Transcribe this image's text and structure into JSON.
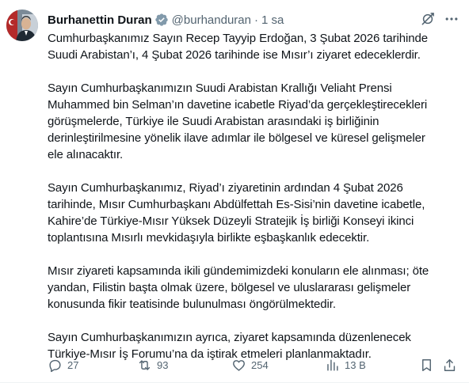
{
  "author": {
    "name": "Burhanettin Duran",
    "handle": "@burhanduran",
    "separator": "·",
    "time": "1 sa"
  },
  "post": {
    "paragraphs": [
      "Cumhurbaşkanımız Sayın Recep Tayyip Erdoğan, 3 Şubat 2026 tarihinde\nSuudi Arabistan’ı, 4 Şubat 2026 tarihinde ise Mısır’ı ziyaret edeceklerdir.",
      "Sayın Cumhurbaşkanımızın Suudi Arabistan Krallığı Veliaht Prensi\nMuhammed bin Selman’ın davetine icabetle Riyad’da gerçekleştirecekleri\ngörüşmelerde, Türkiye ile Suudi Arabistan arasındaki iş birliğinin\nderinleştirilmesine yönelik ilave adımlar ile bölgesel ve küresel gelişmeler\nele alınacaktır.",
      "Sayın Cumhurbaşkanımız, Riyad’ı ziyaretinin ardından 4 Şubat 2026\ntarihinde, Mısır Cumhurbaşkanı Abdülfettah Es-Sisi’nin davetine icabetle,\nKahire’de Türkiye-Mısır Yüksek Düzeyli Stratejik İş birliği Konseyi ikinci\ntoplantısına Mısırlı mevkidaşıyla birlikte eşbaşkanlık edecektir.",
      "Mısır ziyareti kapsamında ikili gündemimizdeki konuların ele alınması; öte\nyandan, Filistin başta olmak üzere, bölgesel ve uluslararası gelişmeler\nkonusunda fikir teatisinde bulunulması öngörülmektedir.",
      "Sayın Cumhurbaşkanımızın ayrıca, ziyaret kapsamında düzenlenecek\nTürkiye-Mısır İş Forumu’na da iştirak etmeleri planlanmaktadır."
    ]
  },
  "actions": {
    "replies": "27",
    "reposts": "93",
    "likes": "254",
    "views": "13 B"
  },
  "icons": {
    "avatar": "profile-photo",
    "verified": "verified-badge-icon",
    "grok": "grok-icon",
    "more": "more-icon",
    "reply": "reply-icon",
    "repost": "repost-icon",
    "like": "heart-icon",
    "views": "views-icon",
    "bookmark": "bookmark-icon",
    "share": "share-icon"
  },
  "colors": {
    "text": "#0f1419",
    "secondary": "#536471",
    "verified": "#829aab"
  }
}
